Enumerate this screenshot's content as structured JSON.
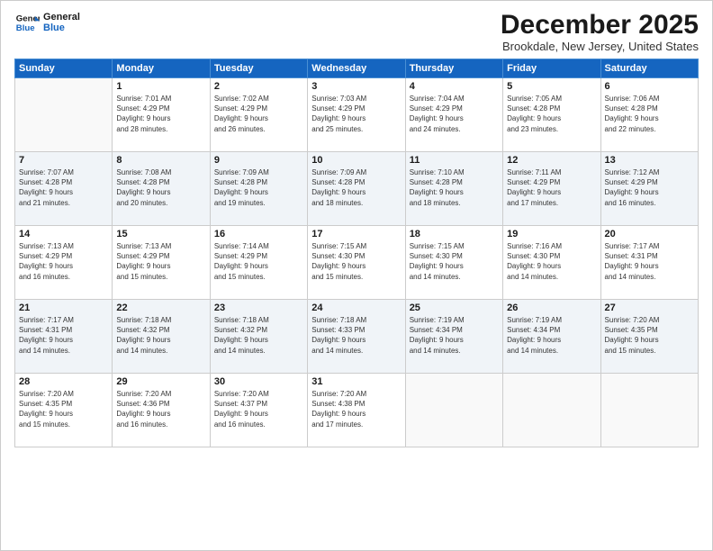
{
  "logo": {
    "line1": "General",
    "line2": "Blue"
  },
  "title": "December 2025",
  "location": "Brookdale, New Jersey, United States",
  "weekdays": [
    "Sunday",
    "Monday",
    "Tuesday",
    "Wednesday",
    "Thursday",
    "Friday",
    "Saturday"
  ],
  "weeks": [
    [
      {
        "day": "",
        "info": ""
      },
      {
        "day": "1",
        "info": "Sunrise: 7:01 AM\nSunset: 4:29 PM\nDaylight: 9 hours\nand 28 minutes."
      },
      {
        "day": "2",
        "info": "Sunrise: 7:02 AM\nSunset: 4:29 PM\nDaylight: 9 hours\nand 26 minutes."
      },
      {
        "day": "3",
        "info": "Sunrise: 7:03 AM\nSunset: 4:29 PM\nDaylight: 9 hours\nand 25 minutes."
      },
      {
        "day": "4",
        "info": "Sunrise: 7:04 AM\nSunset: 4:29 PM\nDaylight: 9 hours\nand 24 minutes."
      },
      {
        "day": "5",
        "info": "Sunrise: 7:05 AM\nSunset: 4:28 PM\nDaylight: 9 hours\nand 23 minutes."
      },
      {
        "day": "6",
        "info": "Sunrise: 7:06 AM\nSunset: 4:28 PM\nDaylight: 9 hours\nand 22 minutes."
      }
    ],
    [
      {
        "day": "7",
        "info": "Sunrise: 7:07 AM\nSunset: 4:28 PM\nDaylight: 9 hours\nand 21 minutes."
      },
      {
        "day": "8",
        "info": "Sunrise: 7:08 AM\nSunset: 4:28 PM\nDaylight: 9 hours\nand 20 minutes."
      },
      {
        "day": "9",
        "info": "Sunrise: 7:09 AM\nSunset: 4:28 PM\nDaylight: 9 hours\nand 19 minutes."
      },
      {
        "day": "10",
        "info": "Sunrise: 7:09 AM\nSunset: 4:28 PM\nDaylight: 9 hours\nand 18 minutes."
      },
      {
        "day": "11",
        "info": "Sunrise: 7:10 AM\nSunset: 4:28 PM\nDaylight: 9 hours\nand 18 minutes."
      },
      {
        "day": "12",
        "info": "Sunrise: 7:11 AM\nSunset: 4:29 PM\nDaylight: 9 hours\nand 17 minutes."
      },
      {
        "day": "13",
        "info": "Sunrise: 7:12 AM\nSunset: 4:29 PM\nDaylight: 9 hours\nand 16 minutes."
      }
    ],
    [
      {
        "day": "14",
        "info": "Sunrise: 7:13 AM\nSunset: 4:29 PM\nDaylight: 9 hours\nand 16 minutes."
      },
      {
        "day": "15",
        "info": "Sunrise: 7:13 AM\nSunset: 4:29 PM\nDaylight: 9 hours\nand 15 minutes."
      },
      {
        "day": "16",
        "info": "Sunrise: 7:14 AM\nSunset: 4:29 PM\nDaylight: 9 hours\nand 15 minutes."
      },
      {
        "day": "17",
        "info": "Sunrise: 7:15 AM\nSunset: 4:30 PM\nDaylight: 9 hours\nand 15 minutes."
      },
      {
        "day": "18",
        "info": "Sunrise: 7:15 AM\nSunset: 4:30 PM\nDaylight: 9 hours\nand 14 minutes."
      },
      {
        "day": "19",
        "info": "Sunrise: 7:16 AM\nSunset: 4:30 PM\nDaylight: 9 hours\nand 14 minutes."
      },
      {
        "day": "20",
        "info": "Sunrise: 7:17 AM\nSunset: 4:31 PM\nDaylight: 9 hours\nand 14 minutes."
      }
    ],
    [
      {
        "day": "21",
        "info": "Sunrise: 7:17 AM\nSunset: 4:31 PM\nDaylight: 9 hours\nand 14 minutes."
      },
      {
        "day": "22",
        "info": "Sunrise: 7:18 AM\nSunset: 4:32 PM\nDaylight: 9 hours\nand 14 minutes."
      },
      {
        "day": "23",
        "info": "Sunrise: 7:18 AM\nSunset: 4:32 PM\nDaylight: 9 hours\nand 14 minutes."
      },
      {
        "day": "24",
        "info": "Sunrise: 7:18 AM\nSunset: 4:33 PM\nDaylight: 9 hours\nand 14 minutes."
      },
      {
        "day": "25",
        "info": "Sunrise: 7:19 AM\nSunset: 4:34 PM\nDaylight: 9 hours\nand 14 minutes."
      },
      {
        "day": "26",
        "info": "Sunrise: 7:19 AM\nSunset: 4:34 PM\nDaylight: 9 hours\nand 14 minutes."
      },
      {
        "day": "27",
        "info": "Sunrise: 7:20 AM\nSunset: 4:35 PM\nDaylight: 9 hours\nand 15 minutes."
      }
    ],
    [
      {
        "day": "28",
        "info": "Sunrise: 7:20 AM\nSunset: 4:35 PM\nDaylight: 9 hours\nand 15 minutes."
      },
      {
        "day": "29",
        "info": "Sunrise: 7:20 AM\nSunset: 4:36 PM\nDaylight: 9 hours\nand 16 minutes."
      },
      {
        "day": "30",
        "info": "Sunrise: 7:20 AM\nSunset: 4:37 PM\nDaylight: 9 hours\nand 16 minutes."
      },
      {
        "day": "31",
        "info": "Sunrise: 7:20 AM\nSunset: 4:38 PM\nDaylight: 9 hours\nand 17 minutes."
      },
      {
        "day": "",
        "info": ""
      },
      {
        "day": "",
        "info": ""
      },
      {
        "day": "",
        "info": ""
      }
    ]
  ]
}
